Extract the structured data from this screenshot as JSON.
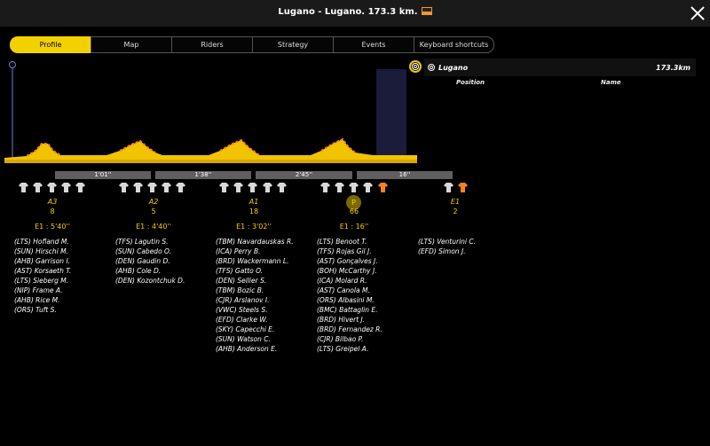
{
  "window": {
    "title": "Lugano - Lugano. 173.3 km."
  },
  "tabs": [
    "Profile",
    "Map",
    "Riders",
    "Strategy",
    "Events",
    "Keyboard shortcuts"
  ],
  "tooltip": {
    "place": "Lugano",
    "distance": "173.3km",
    "col_position": "Position",
    "col_name": "Name"
  },
  "gaps": [
    "1'01''",
    "1'38''",
    "2'45''",
    "16''"
  ],
  "groups": [
    {
      "code": "A3",
      "count": "8",
      "time": "E1 : 5'40''",
      "riders": [
        "(LTS) Hofland M.",
        "(SUN) Hirschi M.",
        "(AHB) Garrison I.",
        "(AST) Korsaeth T.",
        "(LTS) Sieberg M.",
        "(NIP) Frame A.",
        "(AHB) Rice M.",
        "(ORS) Tuft S."
      ]
    },
    {
      "code": "A2",
      "count": "5",
      "time": "E1 : 4'40''",
      "riders": [
        "(TFS) Lagutin S.",
        "(SUN) Cabedo O.",
        "(DEN) Gaudin D.",
        "(AHB) Cole D.",
        "(DEN) Kozontchuk D."
      ]
    },
    {
      "code": "A1",
      "count": "18",
      "time": "E1 : 3'02''",
      "riders": [
        "(TBM) Navardauskas R.",
        "(ICA) Perry B.",
        "(BRD) Wackermann L.",
        "(TFS) Gatto O.",
        "(DEN) Sellier S.",
        "(TBM) Bozic B.",
        "(CJR) Arslanov I.",
        "(VWC) Steels S.",
        "(EFD) Clarke W.",
        "(SKY) Capecchi E.",
        "(SUN) Watson C.",
        "(AHB) Anderson E."
      ]
    },
    {
      "code": "P",
      "count": "66",
      "time": "E1 : 16''",
      "riders": [
        "(LTS) Benoot T.",
        "(TFS) Rojas Gil J.",
        "(AST) Gonçalves J.",
        "(BOH) McCarthy J.",
        "(ICA) Molard R.",
        "(AST) Canola M.",
        "(ORS) Albasini M.",
        "(BMC) Battaglin E.",
        "(BRD) Hivert J.",
        "(BRD) Fernandez R.",
        "(CJR) Bilbao P.",
        "(LTS) Greipel A."
      ]
    },
    {
      "code": "E1",
      "count": "2",
      "time": "",
      "riders": [
        "(LTS) Venturini C.",
        "(EFD) Simon J."
      ]
    }
  ],
  "colors": {
    "accent": "#f2d100",
    "highlight": "#f58220",
    "jersey": "#d8d8d8",
    "bar": "#5f5f5f"
  },
  "icons": {
    "close": "close-icon",
    "finish": "finish-flag-icon",
    "jersey": "jersey-icon",
    "screen": "screen-icon"
  }
}
